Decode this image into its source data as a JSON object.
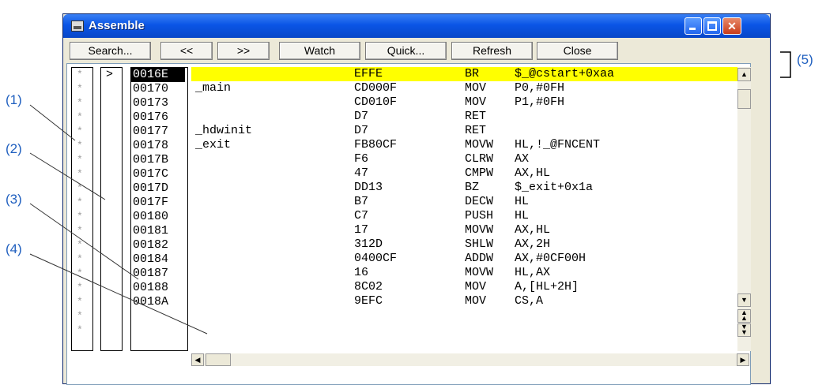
{
  "window": {
    "title": "Assemble",
    "controls": {
      "minimize": "_",
      "maximize": "□",
      "close": "✕"
    }
  },
  "toolbar": {
    "buttons": [
      "Search...",
      "<<",
      ">>",
      "Watch",
      "Quick...",
      "Refresh",
      "Close"
    ]
  },
  "columns": {
    "break_marks": [
      "*",
      "*",
      "*",
      "*",
      "*",
      "*",
      "*",
      "*",
      "*",
      "*",
      "*",
      "*",
      "*",
      "*",
      "*",
      "*",
      "*",
      "*",
      "*"
    ],
    "current_marker": ">"
  },
  "listing": {
    "rows": [
      {
        "address": "0016E",
        "label": "",
        "code": "EFFE",
        "mnemonic": "BR",
        "operand": "$_@cstart+0xaa",
        "highlighted": true
      },
      {
        "address": "00170",
        "label": "_main",
        "code": "CD000F",
        "mnemonic": "MOV",
        "operand": "P0,#0FH",
        "highlighted": false
      },
      {
        "address": "00173",
        "label": "",
        "code": "CD010F",
        "mnemonic": "MOV",
        "operand": "P1,#0FH",
        "highlighted": false
      },
      {
        "address": "00176",
        "label": "",
        "code": "D7",
        "mnemonic": "RET",
        "operand": "",
        "highlighted": false
      },
      {
        "address": "00177",
        "label": "_hdwinit",
        "code": "D7",
        "mnemonic": "RET",
        "operand": "",
        "highlighted": false
      },
      {
        "address": "00178",
        "label": "_exit",
        "code": "FB80CF",
        "mnemonic": "MOVW",
        "operand": "HL,!_@FNCENT",
        "highlighted": false
      },
      {
        "address": "0017B",
        "label": "",
        "code": "F6",
        "mnemonic": "CLRW",
        "operand": "AX",
        "highlighted": false
      },
      {
        "address": "0017C",
        "label": "",
        "code": "47",
        "mnemonic": "CMPW",
        "operand": "AX,HL",
        "highlighted": false
      },
      {
        "address": "0017D",
        "label": "",
        "code": "DD13",
        "mnemonic": "BZ",
        "operand": "$_exit+0x1a",
        "highlighted": false
      },
      {
        "address": "0017F",
        "label": "",
        "code": "B7",
        "mnemonic": "DECW",
        "operand": "HL",
        "highlighted": false
      },
      {
        "address": "00180",
        "label": "",
        "code": "C7",
        "mnemonic": "PUSH",
        "operand": "HL",
        "highlighted": false
      },
      {
        "address": "00181",
        "label": "",
        "code": "17",
        "mnemonic": "MOVW",
        "operand": "AX,HL",
        "highlighted": false
      },
      {
        "address": "00182",
        "label": "",
        "code": "312D",
        "mnemonic": "SHLW",
        "operand": "AX,2H",
        "highlighted": false
      },
      {
        "address": "00184",
        "label": "",
        "code": "0400CF",
        "mnemonic": "ADDW",
        "operand": "AX,#0CF00H",
        "highlighted": false
      },
      {
        "address": "00187",
        "label": "",
        "code": "16",
        "mnemonic": "MOVW",
        "operand": "HL,AX",
        "highlighted": false
      },
      {
        "address": "00188",
        "label": "",
        "code": "8C02",
        "mnemonic": "MOV",
        "operand": "A,[HL+2H]",
        "highlighted": false
      },
      {
        "address": "0018A",
        "label": "",
        "code": "9EFC",
        "mnemonic": "MOV",
        "operand": "CS,A",
        "highlighted": false
      }
    ]
  },
  "callouts": [
    "(1)",
    "(2)",
    "(3)",
    "(4)",
    "(5)"
  ],
  "colors": {
    "highlight": "#ffff00",
    "callout": "#1f5fbf",
    "title_bar": "#0a55e6"
  }
}
